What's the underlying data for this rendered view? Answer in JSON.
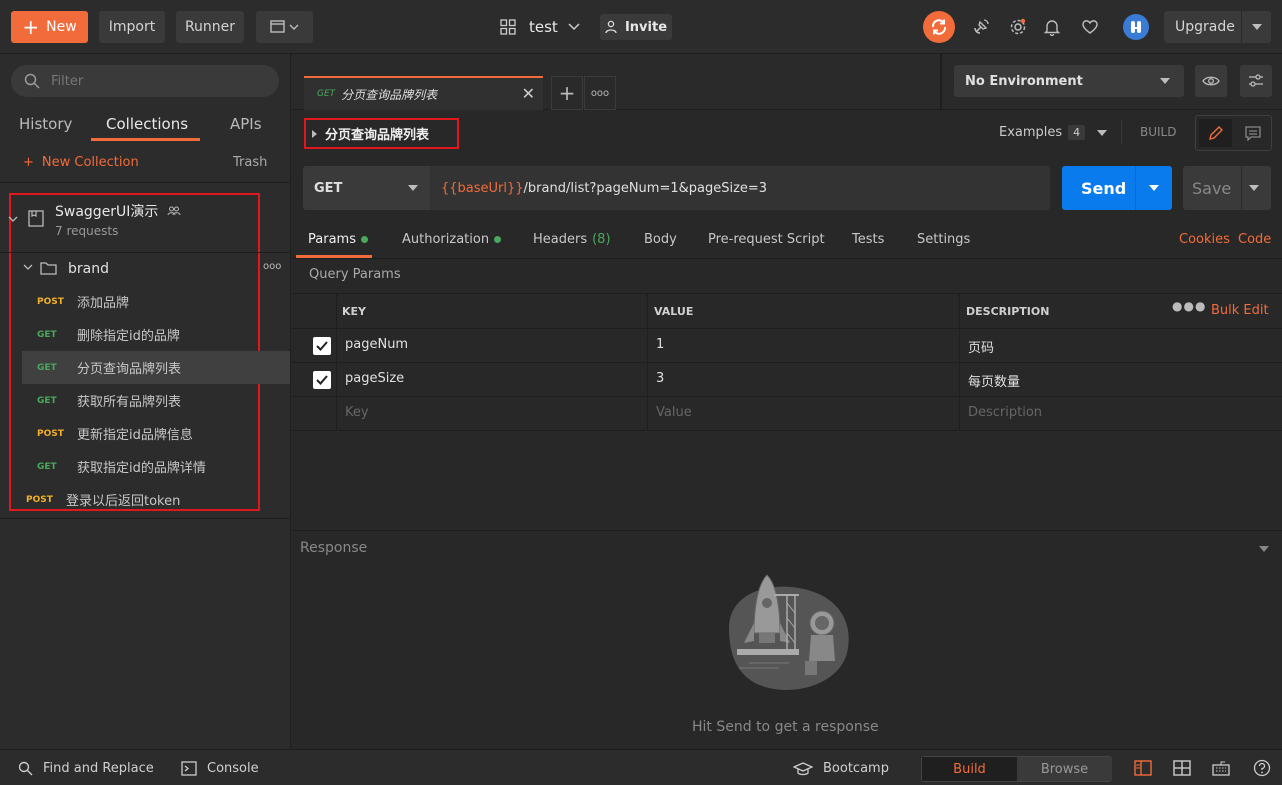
{
  "colors": {
    "accent": "#f26b3a",
    "send": "#097bed",
    "get": "#4aa85c",
    "post": "#f0b027",
    "highlight_box": "#e0181e"
  },
  "toolbar": {
    "new_label": "New",
    "import_label": "Import",
    "runner_label": "Runner",
    "workspace": "test",
    "invite_label": "Invite",
    "upgrade_label": "Upgrade"
  },
  "sidebar": {
    "filter_placeholder": "Filter",
    "tabs": [
      "History",
      "Collections",
      "APIs"
    ],
    "new_collection": "New Collection",
    "trash": "Trash",
    "collection": {
      "name": "SwaggerUI演示",
      "count": "7 requests"
    },
    "folder": {
      "name": "brand"
    },
    "requests": [
      {
        "method": "POST",
        "name": "添加品牌"
      },
      {
        "method": "GET",
        "name": "删除指定id的品牌"
      },
      {
        "method": "GET",
        "name": "分页查询品牌列表"
      },
      {
        "method": "GET",
        "name": "获取所有品牌列表"
      },
      {
        "method": "POST",
        "name": "更新指定id品牌信息"
      },
      {
        "method": "GET",
        "name": "获取指定id的品牌详情"
      }
    ],
    "root_request": {
      "method": "POST",
      "name": "登录以后返回token"
    }
  },
  "tab": {
    "method": "GET",
    "title": "分页查询品牌列表"
  },
  "environment": {
    "selected": "No Environment"
  },
  "request": {
    "title": "分页查询品牌列表",
    "examples_label": "Examples",
    "examples_count": "4",
    "build_label": "BUILD",
    "method": "GET",
    "url_var": "{{baseUrl}}",
    "url_rest": "/brand/list?pageNum=1&pageSize=3",
    "send_label": "Send",
    "save_label": "Save"
  },
  "req_tabs": {
    "params": "Params",
    "authorization": "Authorization",
    "headers": "Headers",
    "headers_count": "(8)",
    "body": "Body",
    "prerequest": "Pre-request Script",
    "tests": "Tests",
    "settings": "Settings",
    "cookies": "Cookies",
    "code": "Code"
  },
  "params": {
    "section_label": "Query Params",
    "columns": {
      "key": "KEY",
      "value": "VALUE",
      "description": "DESCRIPTION"
    },
    "bulk_edit": "Bulk Edit",
    "rows": [
      {
        "key": "pageNum",
        "value": "1",
        "description": "页码"
      },
      {
        "key": "pageSize",
        "value": "3",
        "description": "每页数量"
      }
    ],
    "placeholder": {
      "key": "Key",
      "value": "Value",
      "description": "Description"
    }
  },
  "response": {
    "label": "Response",
    "hint": "Hit Send to get a response"
  },
  "bottom": {
    "find_replace": "Find and Replace",
    "console": "Console",
    "bootcamp": "Bootcamp",
    "build": "Build",
    "browse": "Browse"
  }
}
